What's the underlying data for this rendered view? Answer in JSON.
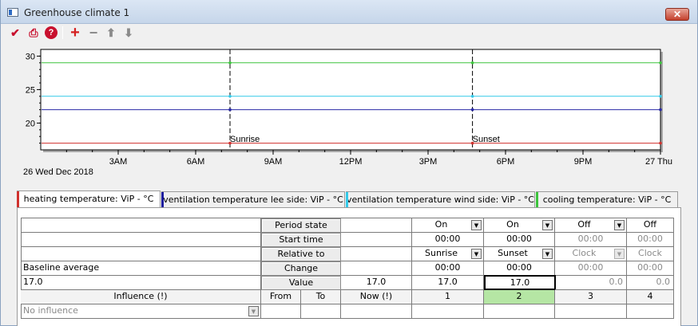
{
  "window": {
    "title": "Greenhouse climate 1",
    "close_glyph": "✕"
  },
  "toolbar": {
    "buttons": [
      {
        "name": "checkmark-icon",
        "glyph": "✔",
        "color": "#c8102e"
      },
      {
        "name": "printer-icon",
        "glyph": "⎙",
        "color": "#c8102e"
      },
      {
        "name": "help-icon",
        "glyph": "?",
        "color": "#c8102e"
      },
      {
        "name": "add-icon",
        "glyph": "+",
        "color": "#d42020"
      },
      {
        "name": "remove-icon",
        "glyph": "−",
        "color": "#8a8a8a"
      },
      {
        "name": "arrow-up-icon",
        "glyph": "⬆",
        "color": "#8a8a8a"
      },
      {
        "name": "arrow-down-icon",
        "glyph": "⬇",
        "color": "#8a8a8a"
      }
    ]
  },
  "chart_data": {
    "type": "line",
    "ylim": [
      16,
      31
    ],
    "yticks": [
      20,
      25,
      30
    ],
    "xlim": [
      0,
      24
    ],
    "xticks": [
      {
        "x": 3,
        "label": "3AM"
      },
      {
        "x": 6,
        "label": "6AM"
      },
      {
        "x": 9,
        "label": "9AM"
      },
      {
        "x": 12,
        "label": "12PM"
      },
      {
        "x": 15,
        "label": "3PM"
      },
      {
        "x": 18,
        "label": "6PM"
      },
      {
        "x": 21,
        "label": "9PM"
      },
      {
        "x": 24,
        "label": "27 Thu"
      }
    ],
    "start_date_label": "26 Wed Dec 2018",
    "series": [
      {
        "color": "#d0312d",
        "points": [
          [
            7.33,
            17
          ],
          [
            16.72,
            17
          ],
          [
            24,
            17
          ]
        ]
      },
      {
        "color": "#2a2aa6",
        "points": [
          [
            7.33,
            22
          ],
          [
            16.72,
            22
          ],
          [
            24,
            22
          ]
        ]
      },
      {
        "color": "#33c9e8",
        "points": [
          [
            7.33,
            24
          ],
          [
            16.72,
            24
          ],
          [
            24,
            24
          ]
        ]
      },
      {
        "color": "#3cc43c",
        "points": [
          [
            7.33,
            29
          ],
          [
            16.72,
            29
          ],
          [
            24,
            29
          ]
        ]
      }
    ],
    "events": [
      {
        "x": 7.33,
        "label": "Sunrise"
      },
      {
        "x": 16.72,
        "label": "Sunset"
      }
    ]
  },
  "tabs": [
    {
      "label": "heating temperature: ViP - °C",
      "color": "#d0312d",
      "active": true
    },
    {
      "label": "ventilation temperature lee side: ViP - °C",
      "color": "#1a1a9e",
      "active": false
    },
    {
      "label": "ventilation temperature wind side: ViP - °C",
      "color": "#33c9e8",
      "active": false
    },
    {
      "label": "cooling temperature: ViP - °C",
      "color": "#3cc43c",
      "active": false
    }
  ],
  "table": {
    "baseline_label": "Baseline average",
    "baseline_value": "17.0",
    "row_labels": {
      "period_state": "Period state",
      "start_time": "Start time",
      "relative_to": "Relative to",
      "change": "Change",
      "value": "Value"
    },
    "value_now": "17.0",
    "header": {
      "influence": "Influence (!)",
      "from": "From",
      "to": "To",
      "now": "Now (!)"
    },
    "influence_value": "No influence",
    "periods": [
      {
        "number": "1",
        "state": "On",
        "start": "00:00",
        "relative": "Sunrise",
        "change": "00:00",
        "value": "17.0",
        "enabled": true
      },
      {
        "number": "2",
        "state": "On",
        "start": "00:00",
        "relative": "Sunset",
        "change": "00:00",
        "value": "17.0",
        "enabled": true
      },
      {
        "number": "3",
        "state": "Off",
        "start": "00:00",
        "relative": "Clock",
        "change": "00:00",
        "value": "0.0",
        "enabled": false
      },
      {
        "number": "4",
        "state": "Off",
        "start": "00:00",
        "relative": "Clock",
        "change": "00:00",
        "value": "0.0",
        "enabled": false
      }
    ]
  }
}
